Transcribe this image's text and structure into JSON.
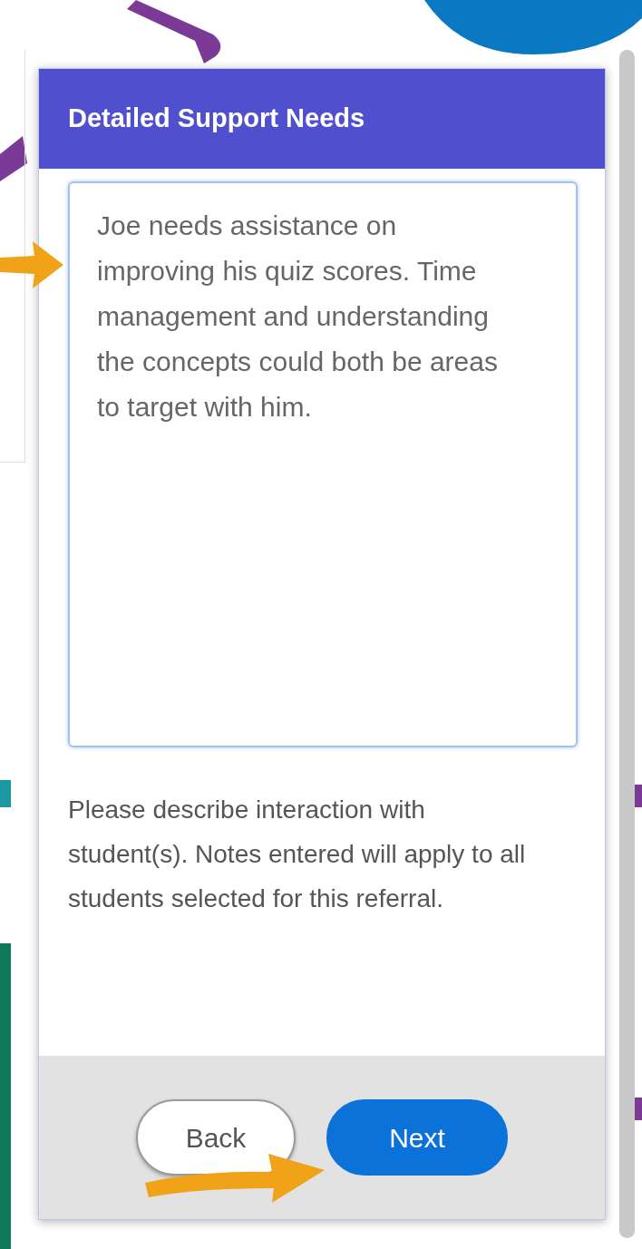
{
  "dialog": {
    "title": "Detailed Support Needs",
    "notes_field": {
      "value": "Joe needs assistance on improving his quiz scores. Time management and understanding the concepts could both be areas to target with him."
    },
    "help_text": "Please describe interaction with student(s). Notes entered will apply to all students selected for this referral.",
    "buttons": [
      {
        "label": "Back",
        "kind": "secondary"
      },
      {
        "label": "Next",
        "kind": "primary"
      }
    ]
  }
}
